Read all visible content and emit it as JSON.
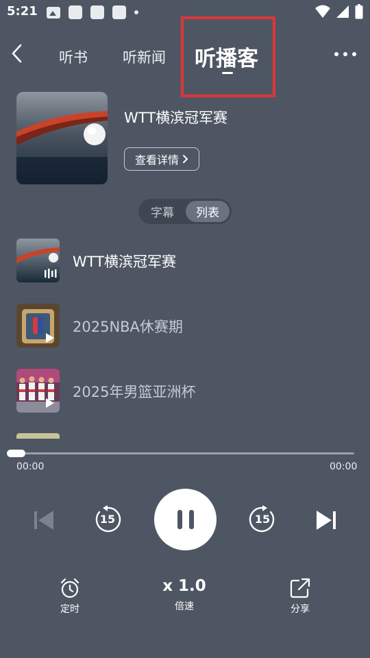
{
  "status_bar": {
    "time": "5:21",
    "notification_icons": [
      "gallery-icon",
      "app-icon",
      "app-icon",
      "app-icon",
      "dot-icon"
    ],
    "right_icons": [
      "wifi-icon",
      "signal-icon",
      "battery-icon"
    ]
  },
  "nav": {
    "tabs": [
      {
        "label": "听书"
      },
      {
        "label": "听新闻"
      }
    ],
    "active_tab": "听播客"
  },
  "podcast": {
    "title": "WTT横滨冠军赛",
    "detail_button": "查看详情"
  },
  "segmented": {
    "subtitle": "字幕",
    "list": "列表",
    "selected": "列表"
  },
  "episodes": [
    {
      "title": "WTT横滨冠军赛",
      "state": "playing"
    },
    {
      "title": "2025NBA休赛期",
      "state": "paused"
    },
    {
      "title": "2025年男篮亚洲杯",
      "state": "paused"
    }
  ],
  "player": {
    "current_time": "00:00",
    "total_time": "00:00",
    "progress": 0.0,
    "skip_back_seconds": "15",
    "skip_forward_seconds": "15",
    "state": "playing"
  },
  "bottom_bar": {
    "timer_label": "定时",
    "speed_value": "x 1.0",
    "speed_label": "倍速",
    "share_label": "分享"
  },
  "colors": {
    "background": "#4e5663",
    "highlight": "#e0353a"
  }
}
